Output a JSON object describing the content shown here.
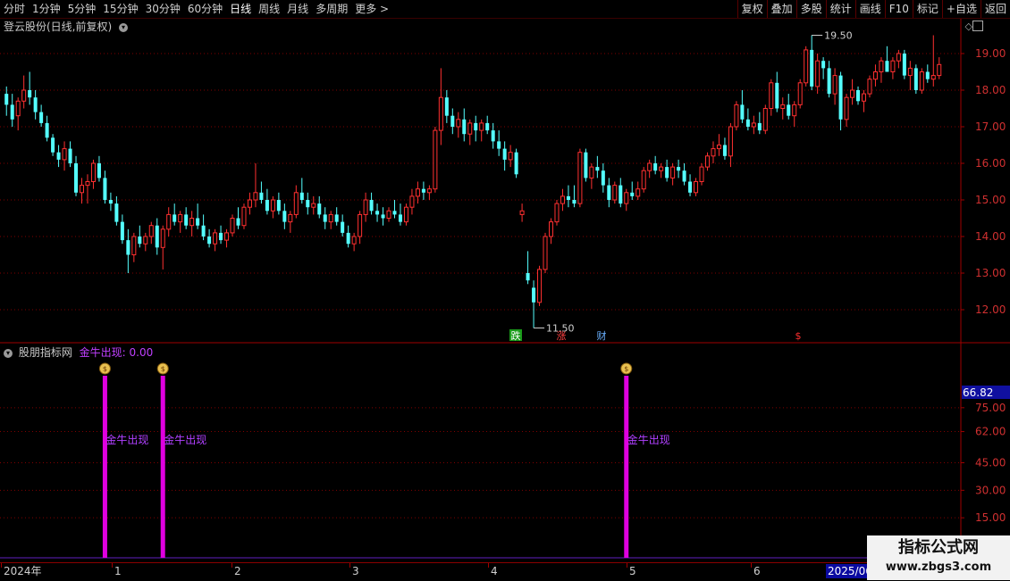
{
  "toolbar": {
    "periods": [
      "分时",
      "1分钟",
      "5分钟",
      "15分钟",
      "30分钟",
      "60分钟",
      "日线",
      "周线",
      "月线",
      "多周期",
      "更多 >"
    ],
    "active_index": 6,
    "buttons": [
      "复权",
      "叠加",
      "多股",
      "统计",
      "画线",
      "F10",
      "标记",
      "+自选",
      "返回"
    ]
  },
  "chart_title": "登云股份(日线,前复权)",
  "indicator": {
    "name": "股朋指标网",
    "formula_label": "金牛出现: 0.00",
    "cursor_value": "66.82",
    "signal_label": "金牛出现",
    "y_ticks": [
      "75.00",
      "62.00",
      "45.00",
      "30.00",
      "15.00"
    ]
  },
  "price_axis": {
    "ticks": [
      "19.00",
      "18.00",
      "17.00",
      "16.00",
      "15.00",
      "14.00",
      "13.00",
      "12.00"
    ]
  },
  "annotations": {
    "high": "19.50",
    "low": "11.50",
    "markers": [
      "跌",
      "涨",
      "财",
      "$"
    ]
  },
  "date_axis": {
    "labels": [
      "2024年",
      "1",
      "2",
      "3",
      "4",
      "5",
      "6"
    ],
    "end_label": "2025/06"
  },
  "watermark": {
    "title": "指标公式网",
    "url": "www.zbgs3.com"
  },
  "colors": {
    "up": "#ff3030",
    "down": "#54ffff",
    "signal": "#e000e0",
    "grid": "#800000",
    "bg": "#000000"
  },
  "chart_data": {
    "type": "candlestick",
    "y_range": [
      11.3,
      20.0
    ],
    "ohlc": [
      [
        17.9,
        18.1,
        17.3,
        17.6
      ],
      [
        17.6,
        17.9,
        17.0,
        17.2
      ],
      [
        17.3,
        17.8,
        16.9,
        17.7
      ],
      [
        17.7,
        18.4,
        17.5,
        18.0
      ],
      [
        18.0,
        18.5,
        17.6,
        17.8
      ],
      [
        17.8,
        18.0,
        17.2,
        17.4
      ],
      [
        17.4,
        17.6,
        17.0,
        17.1
      ],
      [
        17.1,
        17.3,
        16.6,
        16.7
      ],
      [
        16.7,
        16.8,
        16.2,
        16.3
      ],
      [
        16.3,
        16.5,
        15.9,
        16.1
      ],
      [
        16.1,
        16.6,
        15.8,
        16.4
      ],
      [
        16.4,
        16.6,
        15.9,
        16.0
      ],
      [
        16.0,
        16.2,
        15.1,
        15.2
      ],
      [
        15.2,
        15.6,
        14.9,
        15.4
      ],
      [
        15.4,
        15.7,
        14.9,
        15.5
      ],
      [
        15.5,
        16.1,
        15.3,
        16.0
      ],
      [
        16.0,
        16.2,
        15.5,
        15.6
      ],
      [
        15.6,
        15.8,
        14.9,
        15.0
      ],
      [
        15.0,
        15.2,
        14.7,
        14.9
      ],
      [
        14.9,
        15.1,
        14.3,
        14.4
      ],
      [
        14.4,
        14.6,
        13.8,
        13.9
      ],
      [
        13.9,
        14.2,
        13.0,
        13.5
      ],
      [
        13.5,
        14.1,
        13.3,
        14.0
      ],
      [
        14.0,
        14.3,
        13.7,
        13.8
      ],
      [
        13.8,
        14.1,
        13.6,
        14.0
      ],
      [
        14.0,
        14.4,
        13.8,
        14.3
      ],
      [
        14.3,
        14.5,
        13.5,
        13.7
      ],
      [
        13.7,
        14.3,
        13.1,
        14.2
      ],
      [
        14.2,
        14.8,
        14.0,
        14.6
      ],
      [
        14.6,
        14.9,
        14.3,
        14.4
      ],
      [
        14.4,
        14.7,
        14.1,
        14.6
      ],
      [
        14.6,
        14.8,
        14.2,
        14.3
      ],
      [
        14.3,
        14.7,
        14.0,
        14.5
      ],
      [
        14.5,
        14.9,
        14.2,
        14.3
      ],
      [
        14.3,
        14.6,
        13.9,
        14.0
      ],
      [
        14.0,
        14.2,
        13.7,
        13.8
      ],
      [
        13.8,
        14.2,
        13.6,
        14.1
      ],
      [
        14.1,
        14.3,
        13.8,
        13.9
      ],
      [
        13.9,
        14.2,
        13.7,
        14.1
      ],
      [
        14.1,
        14.6,
        14.0,
        14.5
      ],
      [
        14.5,
        14.8,
        14.2,
        14.3
      ],
      [
        14.3,
        14.9,
        14.2,
        14.8
      ],
      [
        14.8,
        15.2,
        14.6,
        15.0
      ],
      [
        15.0,
        16.0,
        14.8,
        15.2
      ],
      [
        15.2,
        15.5,
        14.9,
        15.0
      ],
      [
        15.0,
        15.3,
        14.6,
        14.7
      ],
      [
        14.7,
        15.1,
        14.5,
        15.0
      ],
      [
        15.0,
        15.2,
        14.6,
        14.7
      ],
      [
        14.7,
        14.9,
        14.2,
        14.4
      ],
      [
        14.4,
        14.7,
        14.1,
        14.6
      ],
      [
        14.6,
        15.4,
        14.5,
        15.2
      ],
      [
        15.2,
        15.6,
        14.9,
        15.0
      ],
      [
        15.0,
        15.2,
        14.6,
        14.8
      ],
      [
        14.8,
        15.1,
        14.6,
        14.9
      ],
      [
        14.9,
        15.1,
        14.5,
        14.6
      ],
      [
        14.6,
        14.8,
        14.2,
        14.4
      ],
      [
        14.4,
        14.7,
        14.2,
        14.6
      ],
      [
        14.6,
        14.8,
        14.3,
        14.4
      ],
      [
        14.4,
        14.6,
        14.0,
        14.1
      ],
      [
        14.1,
        14.3,
        13.7,
        13.8
      ],
      [
        13.8,
        14.1,
        13.6,
        14.0
      ],
      [
        14.0,
        14.7,
        13.8,
        14.6
      ],
      [
        14.6,
        15.2,
        14.4,
        15.0
      ],
      [
        15.0,
        15.2,
        14.6,
        14.7
      ],
      [
        14.7,
        14.9,
        14.4,
        14.6
      ],
      [
        14.6,
        14.8,
        14.3,
        14.5
      ],
      [
        14.5,
        14.8,
        14.4,
        14.7
      ],
      [
        14.7,
        15.0,
        14.5,
        14.6
      ],
      [
        14.6,
        14.9,
        14.3,
        14.4
      ],
      [
        14.4,
        14.9,
        14.3,
        14.8
      ],
      [
        14.8,
        15.3,
        14.6,
        15.1
      ],
      [
        15.1,
        15.5,
        14.9,
        15.3
      ],
      [
        15.3,
        15.5,
        15.0,
        15.2
      ],
      [
        15.2,
        15.4,
        15.0,
        15.3
      ],
      [
        15.3,
        17.0,
        15.2,
        16.9
      ],
      [
        16.9,
        18.6,
        16.5,
        17.8
      ],
      [
        17.8,
        18.0,
        17.1,
        17.3
      ],
      [
        17.3,
        17.5,
        16.8,
        17.0
      ],
      [
        17.0,
        17.4,
        16.7,
        17.2
      ],
      [
        17.2,
        17.5,
        16.6,
        16.8
      ],
      [
        16.8,
        17.2,
        16.5,
        17.1
      ],
      [
        17.1,
        17.3,
        16.6,
        16.9
      ],
      [
        16.9,
        17.2,
        16.6,
        17.1
      ],
      [
        17.1,
        17.3,
        16.8,
        16.9
      ],
      [
        16.9,
        17.1,
        16.4,
        16.6
      ],
      [
        16.6,
        16.9,
        16.2,
        16.4
      ],
      [
        16.4,
        16.6,
        15.8,
        16.1
      ],
      [
        16.1,
        16.5,
        15.9,
        16.3
      ],
      [
        16.3,
        16.4,
        15.6,
        15.7
      ],
      [
        14.6,
        14.9,
        14.4,
        14.7
      ],
      [
        13.0,
        13.6,
        12.7,
        12.8
      ],
      [
        12.6,
        12.8,
        11.5,
        12.2
      ],
      [
        12.2,
        13.2,
        12.1,
        13.1
      ],
      [
        13.1,
        14.1,
        13.0,
        14.0
      ],
      [
        14.0,
        14.5,
        13.8,
        14.4
      ],
      [
        14.4,
        15.0,
        14.3,
        14.9
      ],
      [
        14.9,
        15.3,
        14.7,
        15.1
      ],
      [
        15.1,
        15.4,
        14.8,
        15.0
      ],
      [
        15.0,
        15.4,
        14.8,
        14.9
      ],
      [
        14.9,
        16.4,
        14.8,
        16.3
      ],
      [
        16.3,
        16.4,
        15.5,
        15.6
      ],
      [
        15.6,
        16.0,
        15.3,
        15.9
      ],
      [
        15.9,
        16.2,
        15.6,
        15.8
      ],
      [
        15.8,
        16.0,
        15.2,
        15.4
      ],
      [
        15.4,
        15.6,
        14.8,
        15.0
      ],
      [
        15.0,
        15.5,
        14.9,
        15.4
      ],
      [
        15.4,
        15.6,
        14.8,
        14.9
      ],
      [
        14.9,
        15.3,
        14.7,
        15.2
      ],
      [
        15.2,
        15.5,
        15.0,
        15.1
      ],
      [
        15.1,
        15.5,
        15.0,
        15.3
      ],
      [
        15.3,
        15.9,
        15.2,
        15.8
      ],
      [
        15.8,
        16.1,
        15.6,
        16.0
      ],
      [
        16.0,
        16.2,
        15.7,
        15.8
      ],
      [
        15.8,
        16.0,
        15.6,
        15.9
      ],
      [
        15.9,
        16.1,
        15.5,
        15.6
      ],
      [
        15.6,
        16.0,
        15.4,
        15.9
      ],
      [
        15.9,
        16.1,
        15.6,
        15.8
      ],
      [
        15.8,
        16.0,
        15.4,
        15.5
      ],
      [
        15.5,
        15.7,
        15.1,
        15.2
      ],
      [
        15.2,
        15.6,
        15.1,
        15.5
      ],
      [
        15.5,
        16.0,
        15.4,
        15.9
      ],
      [
        15.9,
        16.3,
        15.8,
        16.2
      ],
      [
        16.2,
        16.6,
        16.0,
        16.4
      ],
      [
        16.4,
        16.8,
        16.2,
        16.5
      ],
      [
        16.5,
        16.7,
        16.1,
        16.2
      ],
      [
        16.2,
        17.1,
        15.9,
        17.0
      ],
      [
        17.0,
        17.7,
        16.9,
        17.6
      ],
      [
        17.6,
        18.0,
        17.1,
        17.2
      ],
      [
        17.2,
        17.5,
        16.9,
        17.0
      ],
      [
        17.0,
        17.3,
        16.8,
        17.1
      ],
      [
        17.1,
        17.4,
        16.8,
        16.9
      ],
      [
        16.9,
        17.6,
        16.8,
        17.5
      ],
      [
        17.5,
        18.3,
        17.3,
        18.2
      ],
      [
        18.2,
        18.5,
        17.4,
        17.5
      ],
      [
        17.5,
        17.8,
        17.2,
        17.6
      ],
      [
        17.6,
        17.9,
        17.2,
        17.3
      ],
      [
        17.3,
        17.7,
        17.0,
        17.6
      ],
      [
        17.6,
        18.3,
        17.5,
        18.2
      ],
      [
        18.2,
        19.2,
        18.1,
        19.1
      ],
      [
        19.1,
        19.5,
        18.0,
        18.1
      ],
      [
        18.1,
        19.0,
        17.9,
        18.8
      ],
      [
        18.8,
        18.9,
        18.3,
        18.6
      ],
      [
        18.6,
        18.8,
        17.8,
        17.9
      ],
      [
        17.9,
        18.6,
        17.6,
        18.4
      ],
      [
        18.4,
        18.5,
        16.9,
        17.2
      ],
      [
        17.2,
        17.9,
        17.0,
        17.8
      ],
      [
        17.8,
        18.3,
        17.6,
        18.0
      ],
      [
        18.0,
        18.1,
        17.6,
        17.7
      ],
      [
        17.7,
        18.0,
        17.4,
        17.9
      ],
      [
        17.9,
        18.4,
        17.8,
        18.3
      ],
      [
        18.3,
        18.7,
        18.1,
        18.5
      ],
      [
        18.5,
        18.9,
        18.2,
        18.8
      ],
      [
        18.8,
        19.2,
        18.5,
        18.5
      ],
      [
        18.5,
        18.9,
        18.3,
        18.8
      ],
      [
        18.8,
        19.1,
        18.6,
        19.0
      ],
      [
        19.0,
        19.1,
        18.3,
        18.4
      ],
      [
        18.4,
        18.8,
        18.0,
        18.6
      ],
      [
        18.6,
        18.7,
        17.9,
        18.0
      ],
      [
        18.0,
        18.6,
        17.9,
        18.5
      ],
      [
        18.5,
        18.7,
        18.2,
        18.3
      ],
      [
        18.3,
        19.5,
        18.1,
        18.4
      ],
      [
        18.4,
        18.9,
        18.3,
        18.7
      ]
    ],
    "indicator_signals": [
      17,
      27,
      107
    ],
    "indicator_y_range": [
      0,
      100
    ]
  }
}
